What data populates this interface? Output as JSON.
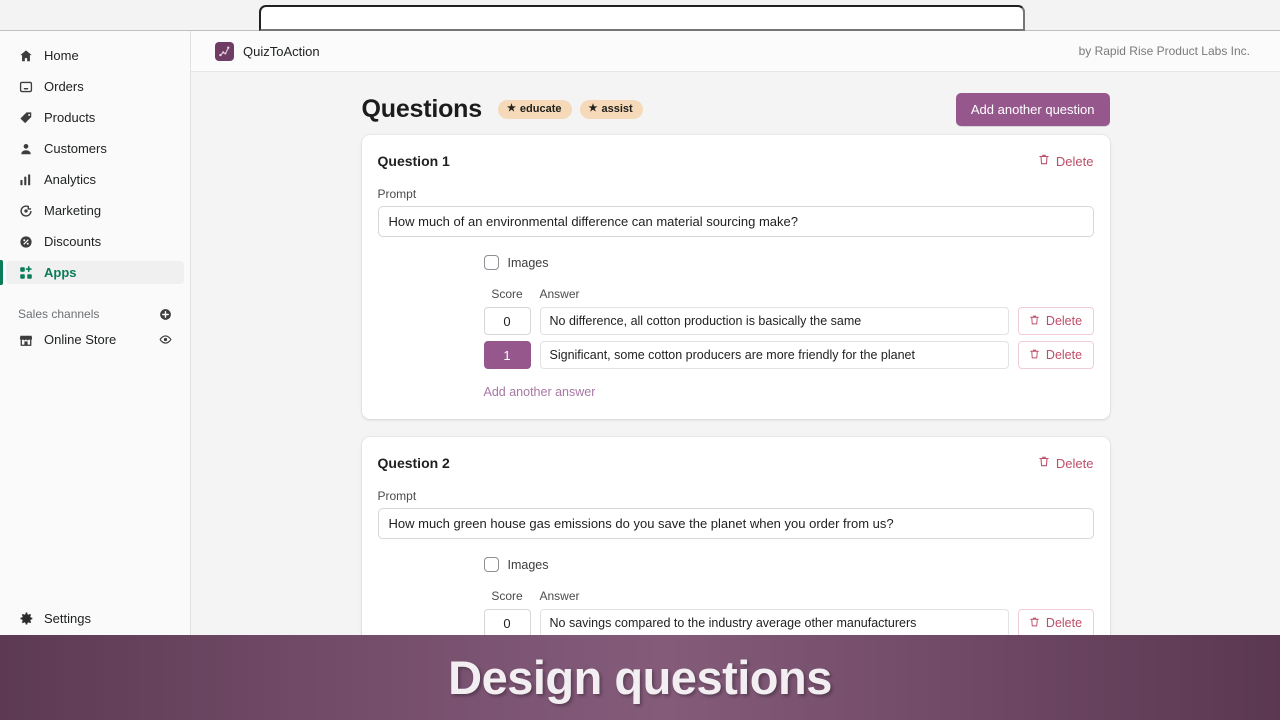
{
  "browser": {
    "url_value": "",
    "url_placeholder": ""
  },
  "sidebar": {
    "items": [
      {
        "label": "Home",
        "icon": "home-icon",
        "active": false
      },
      {
        "label": "Orders",
        "icon": "orders-icon",
        "active": false
      },
      {
        "label": "Products",
        "icon": "products-tag-icon",
        "active": false
      },
      {
        "label": "Customers",
        "icon": "customers-person-icon",
        "active": false
      },
      {
        "label": "Analytics",
        "icon": "analytics-bars-icon",
        "active": false
      },
      {
        "label": "Marketing",
        "icon": "marketing-megaphone-icon",
        "active": false
      },
      {
        "label": "Discounts",
        "icon": "discounts-percent-icon",
        "active": false
      },
      {
        "label": "Apps",
        "icon": "apps-grid-icon",
        "active": true
      }
    ],
    "section_label": "Sales channels",
    "channels": [
      {
        "label": "Online Store",
        "icon": "store-icon",
        "trailing_icon": "eye-icon"
      }
    ],
    "settings": {
      "label": "Settings",
      "icon": "gear-icon"
    }
  },
  "appbar": {
    "app_name": "QuizToAction",
    "by_line": "by Rapid Rise Product Labs Inc.",
    "logo_icon": "quiztoaction-logo"
  },
  "page": {
    "title": "Questions",
    "badges": [
      {
        "label": "educate",
        "icon": "star-icon"
      },
      {
        "label": "assist",
        "icon": "star-icon"
      }
    ],
    "add_question_label": "Add another question"
  },
  "labels": {
    "prompt": "Prompt",
    "images": "Images",
    "score": "Score",
    "answer": "Answer",
    "delete": "Delete",
    "add_answer": "Add another answer"
  },
  "questions": [
    {
      "title": "Question 1",
      "prompt": "How much of an environmental difference can material sourcing make?",
      "images_checked": false,
      "answers": [
        {
          "score": "0",
          "selected": false,
          "text": "No difference, all cotton production is basically the same"
        },
        {
          "score": "1",
          "selected": true,
          "text": "Significant, some cotton producers are more friendly for the planet"
        }
      ]
    },
    {
      "title": "Question 2",
      "prompt": "How much green house gas emissions do you save the planet when you order from us?",
      "images_checked": false,
      "answers": [
        {
          "score": "0",
          "selected": false,
          "text": "No savings compared to the industry average other manufacturers"
        }
      ]
    }
  ],
  "banner": {
    "text": "Design questions"
  },
  "colors": {
    "brand_purple": "#96588c",
    "banner_purple": "#7d5574",
    "accent_green": "#0c7b5a",
    "delete_red": "#bd4e69",
    "badge_bg": "#f5d9b8",
    "link_purple": "#a877a5"
  }
}
